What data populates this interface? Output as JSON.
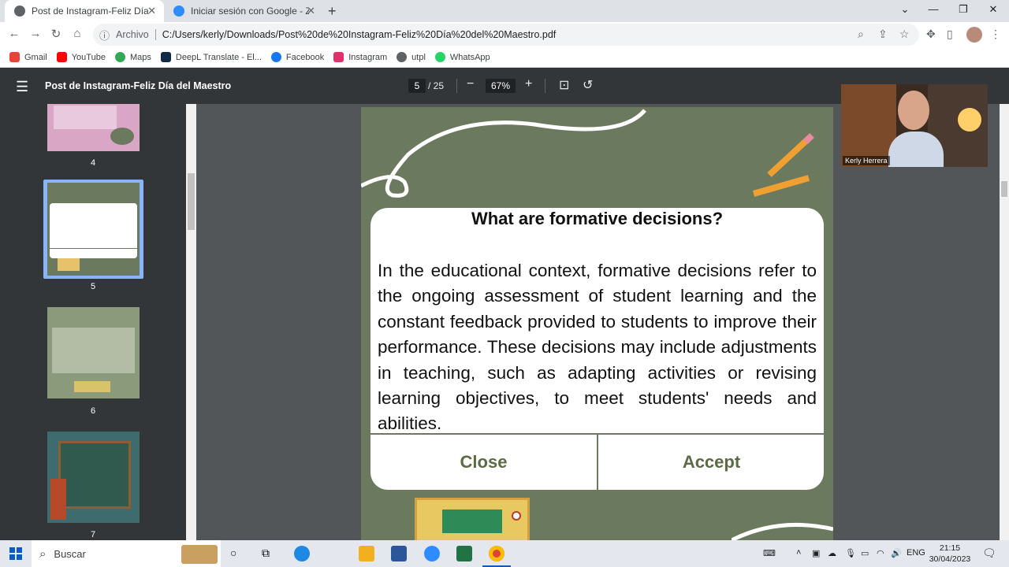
{
  "browser": {
    "tabs": [
      {
        "title": "Post de Instagram-Feliz Día del M",
        "active": true
      },
      {
        "title": "Iniciar sesión con Google - Zoom",
        "active": false
      }
    ],
    "new_tab_glyph": "+",
    "address": {
      "scheme_label": "Archivo",
      "url": "C:/Users/kerly/Downloads/Post%20de%20Instagram-Feliz%20Día%20del%20Maestro.pdf"
    },
    "bookmarks": [
      {
        "label": "Gmail",
        "icon": "gmail-icon",
        "color": "#ea4335"
      },
      {
        "label": "YouTube",
        "icon": "youtube-icon",
        "color": "#ff0000"
      },
      {
        "label": "Maps",
        "icon": "maps-icon",
        "color": "#34a853"
      },
      {
        "label": "DeepL Translate - El...",
        "icon": "deepl-icon",
        "color": "#0f2b46"
      },
      {
        "label": "Facebook",
        "icon": "facebook-icon",
        "color": "#1877f2"
      },
      {
        "label": "Instagram",
        "icon": "instagram-icon",
        "color": "#e1306c"
      },
      {
        "label": "utpl",
        "icon": "globe-icon",
        "color": "#5f6368"
      },
      {
        "label": "WhatsApp",
        "icon": "whatsapp-icon",
        "color": "#25d366"
      }
    ]
  },
  "pdf": {
    "title": "Post de Instagram-Feliz Día del Maestro",
    "current_page": "5",
    "total_pages": "/ 25",
    "zoom": "67%",
    "thumbnails": [
      {
        "label": "4",
        "color": "#d9a6c6"
      },
      {
        "label": "5",
        "color": "#6b7a5e",
        "selected": true
      },
      {
        "label": "6",
        "color": "#8a9a7a"
      },
      {
        "label": "7",
        "color": "#3e6b6e"
      }
    ],
    "slide": {
      "title": "What are formative decisions?",
      "body": "In the educational context, formative decisions refer to the ongoing assessment of student learning and the constant feedback provided to students to improve their performance. These decisions may include adjustments in teaching, such as adapting activities or revising learning objectives, to meet students' needs and abilities.",
      "close_label": "Close",
      "accept_label": "Accept",
      "background_color": "#6b7a5e"
    }
  },
  "zoom_overlay": {
    "participant_name": "Kerly Herrera"
  },
  "taskbar": {
    "search_placeholder": "Buscar",
    "language": "ENG",
    "time": "21:15",
    "date": "30/04/2023"
  }
}
